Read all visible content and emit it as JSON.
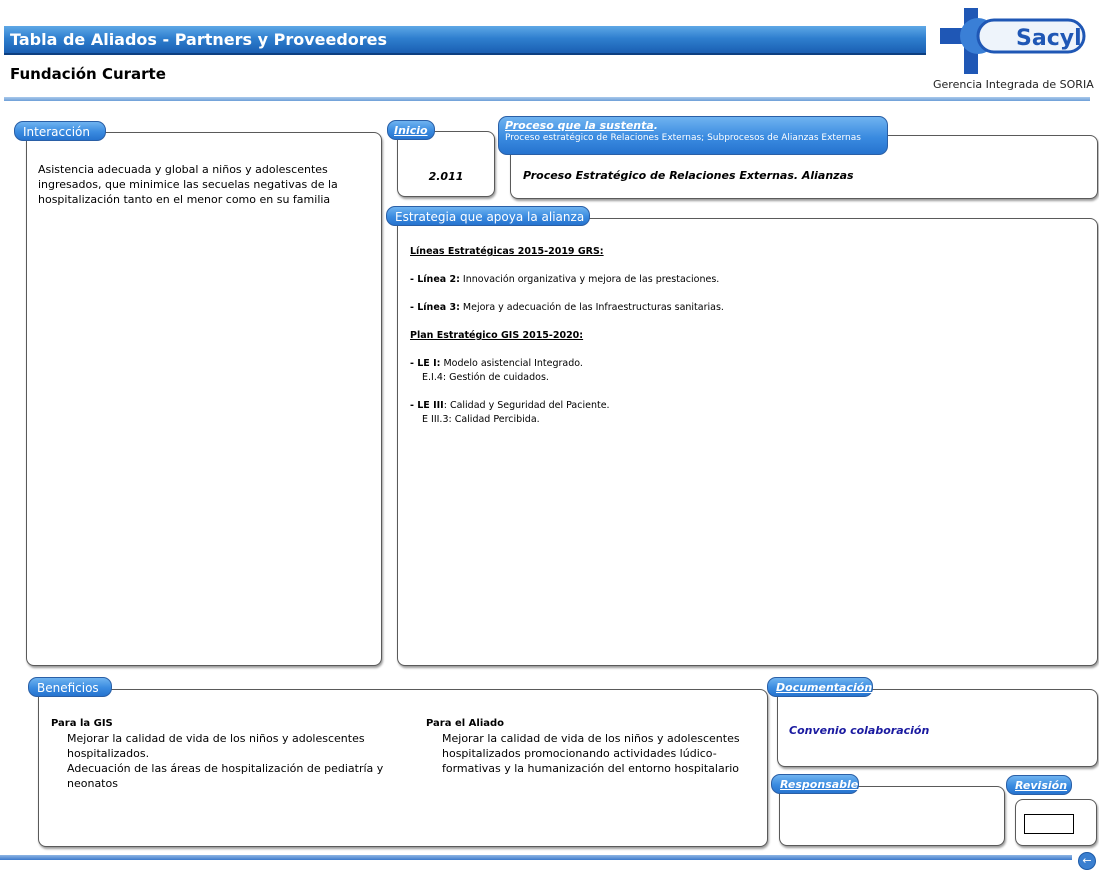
{
  "header": {
    "title": "Tabla de Aliados - Partners y Proveedores",
    "organization": "Fundación Curarte",
    "logo_text": "Sacyl",
    "gerencia": "Gerencia Integrada de SORIA"
  },
  "interaccion": {
    "tab": "Interacción",
    "text": "Asistencia adecuada y global  a niños y adolescentes ingresados, que minimice las secuelas negativas de la hospitalización tanto en el menor como en su familia"
  },
  "inicio": {
    "tab": "Inicio",
    "value": "2.011"
  },
  "proceso": {
    "tab": "Proceso que la sustenta",
    "tab_dot": ".",
    "subtitle": "Proceso estratégico de Relaciones Externas; Subprocesos de Alianzas Externas",
    "value": "Proceso Estratégico de Relaciones Externas. Alianzas"
  },
  "estrategia": {
    "tab": "Estrategia que apoya la alianza",
    "grs_heading": "Líneas Estratégicas 2015-2019  GRS:",
    "linea2_label": "- Línea 2:",
    "linea2_text": " Innovación organizativa y mejora de las prestaciones.",
    "linea3_label": "- Línea 3:",
    "linea3_text": " Mejora y adecuación de las Infraestructuras sanitarias.",
    "gis_heading": "Plan Estratégico GIS 2015-2020:",
    "le1_label": "- LE I:",
    "le1_text": " Modelo asistencial Integrado.",
    "le1_sub": "E.I.4: Gestión de cuidados.",
    "le3_label": "- LE III",
    "le3_text": ": Calidad y Seguridad del Paciente.",
    "le3_sub": "E III.3: Calidad Percibida."
  },
  "beneficios": {
    "tab": "Beneficios",
    "gis_heading": "Para la GIS",
    "gis_items": [
      "Mejorar la calidad de vida de los niños y adolescentes hospitalizados.",
      "Adecuación de las áreas de hospitalización de pediatría y neonatos"
    ],
    "aliado_heading": "Para el Aliado",
    "aliado_items": [
      "Mejorar la calidad de vida de los niños y adolescentes hospitalizados promocionando actividades lúdico-formativas y la humanización del entorno hospitalario"
    ]
  },
  "documentacion": {
    "tab": "Documentación",
    "value": "Convenio colaboración",
    "value_color": "#1a1aa0"
  },
  "responsable": {
    "tab": "Responsable"
  },
  "revision": {
    "tab": "Revisión"
  }
}
